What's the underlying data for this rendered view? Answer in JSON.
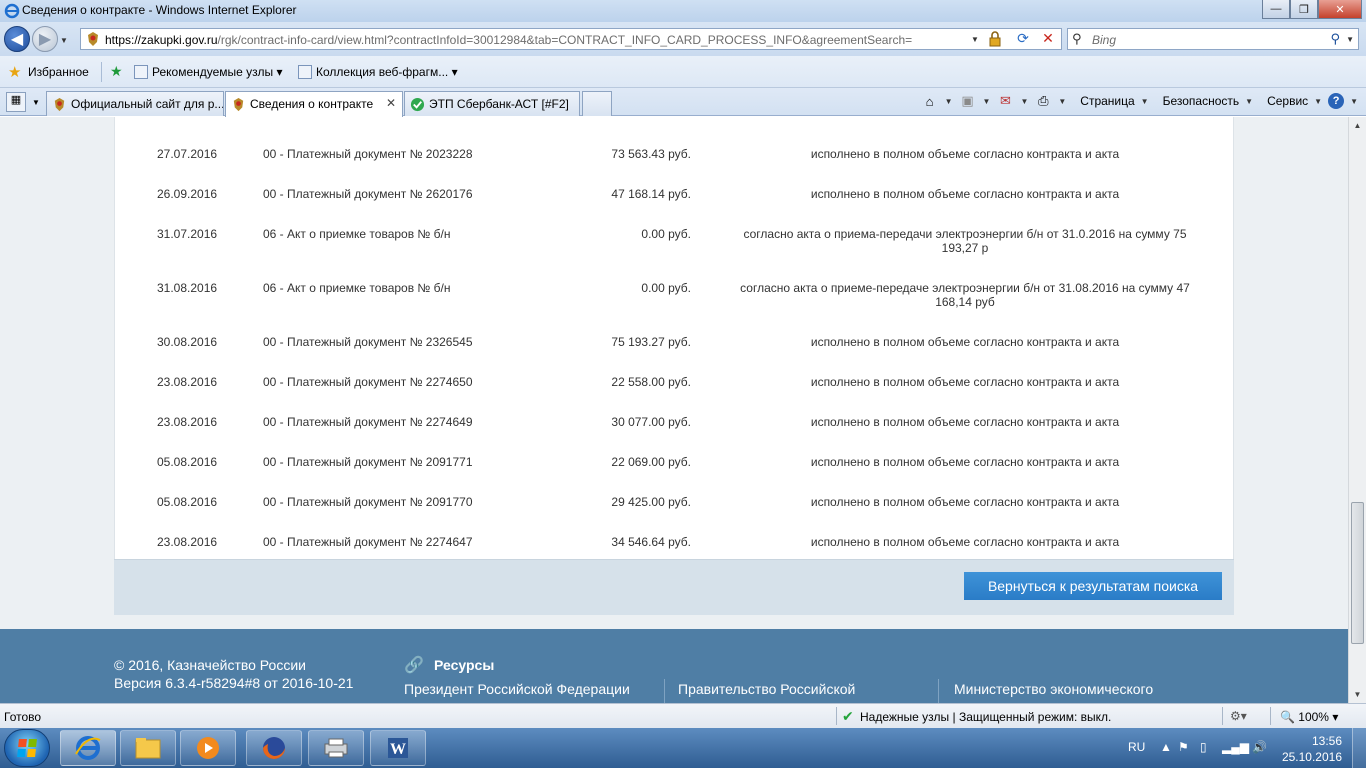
{
  "window": {
    "title": "Сведения о контракте - Windows Internet Explorer",
    "buttons": {
      "minimize": "—",
      "maximize": "❐",
      "close": "✕"
    }
  },
  "address": {
    "url_host": "https://zakupki.gov.ru",
    "url_path": "/rgk/contract-info-card/view.html?contractInfoId=30012984&tab=CONTRACT_INFO_CARD_PROCESS_INFO&agreementSearch=",
    "search_placeholder": "Bing"
  },
  "favorites": {
    "label": "Избранное",
    "items": [
      "Рекомендуемые узлы ▾",
      "Коллекция веб-фрагм... ▾"
    ]
  },
  "tabs": [
    {
      "label": "Официальный сайт для р..."
    },
    {
      "label": "Сведения о контракте",
      "close": "✕"
    },
    {
      "label": "ЭТП Сбербанк-АСТ [#F2]"
    }
  ],
  "commandbar": {
    "page": "Страница",
    "safety": "Безопасность",
    "tools": "Сервис"
  },
  "table": {
    "rows": [
      {
        "date": "27.07.2016",
        "doc": "00 - Платежный документ № 2023228",
        "amount": "73 563.43 руб.",
        "note": "исполнено в полном объеме согласно контракта и акта"
      },
      {
        "date": "26.09.2016",
        "doc": "00 - Платежный документ № 2620176",
        "amount": "47 168.14 руб.",
        "note": "исполнено в полном объеме согласно контракта и акта"
      },
      {
        "date": "31.07.2016",
        "doc": "06 - Акт о приемке товаров № б/н",
        "amount": "0.00 руб.",
        "note": "согласно акта о приема-передачи электроэнергии б/н от 31.0.2016 на сумму 75 193,27 р"
      },
      {
        "date": "31.08.2016",
        "doc": "06 - Акт о приемке товаров № б/н",
        "amount": "0.00 руб.",
        "note": "согласно акта о приеме-передаче электроэнергии б/н от 31.08.2016 на сумму 47 168,14 руб"
      },
      {
        "date": "30.08.2016",
        "doc": "00 - Платежный документ № 2326545",
        "amount": "75 193.27 руб.",
        "note": "исполнено в полном объеме согласно контракта и акта"
      },
      {
        "date": "23.08.2016",
        "doc": "00 - Платежный документ № 2274650",
        "amount": "22 558.00 руб.",
        "note": "исполнено в полном объеме согласно контракта и акта"
      },
      {
        "date": "23.08.2016",
        "doc": "00 - Платежный документ № 2274649",
        "amount": "30 077.00 руб.",
        "note": "исполнено в полном объеме согласно контракта и акта"
      },
      {
        "date": "05.08.2016",
        "doc": "00 - Платежный документ № 2091771",
        "amount": "22 069.00 руб.",
        "note": "исполнено в полном объеме согласно контракта и акта"
      },
      {
        "date": "05.08.2016",
        "doc": "00 - Платежный документ № 2091770",
        "amount": "29 425.00 руб.",
        "note": "исполнено в полном объеме согласно контракта и акта"
      },
      {
        "date": "23.08.2016",
        "doc": "00 - Платежный документ № 2274647",
        "amount": "34 546.64 руб.",
        "note": "исполнено в полном объеме согласно контракта и акта"
      }
    ]
  },
  "back_button": "Вернуться к результатам поиска",
  "footer": {
    "copyright": "© 2016, Казначейство России",
    "version": "Версия 6.3.4-r58294#8 от 2016-10-21",
    "resources_title": "Ресурсы",
    "links": [
      "Президент Российской Федерации",
      "Правительство Российской",
      "Министерство экономического"
    ]
  },
  "status": {
    "text": "Готово",
    "zone": "Надежные узлы | Защищенный режим: выкл.",
    "zoom": "100%"
  },
  "taskbar": {
    "lang": "RU",
    "time": "13:56",
    "date": "25.10.2016"
  },
  "colors": {
    "accent": "#2a7cc7",
    "footer": "#4f7ea5",
    "page_bg": "#ecf0f3",
    "trusted_check": "#23a33a"
  }
}
